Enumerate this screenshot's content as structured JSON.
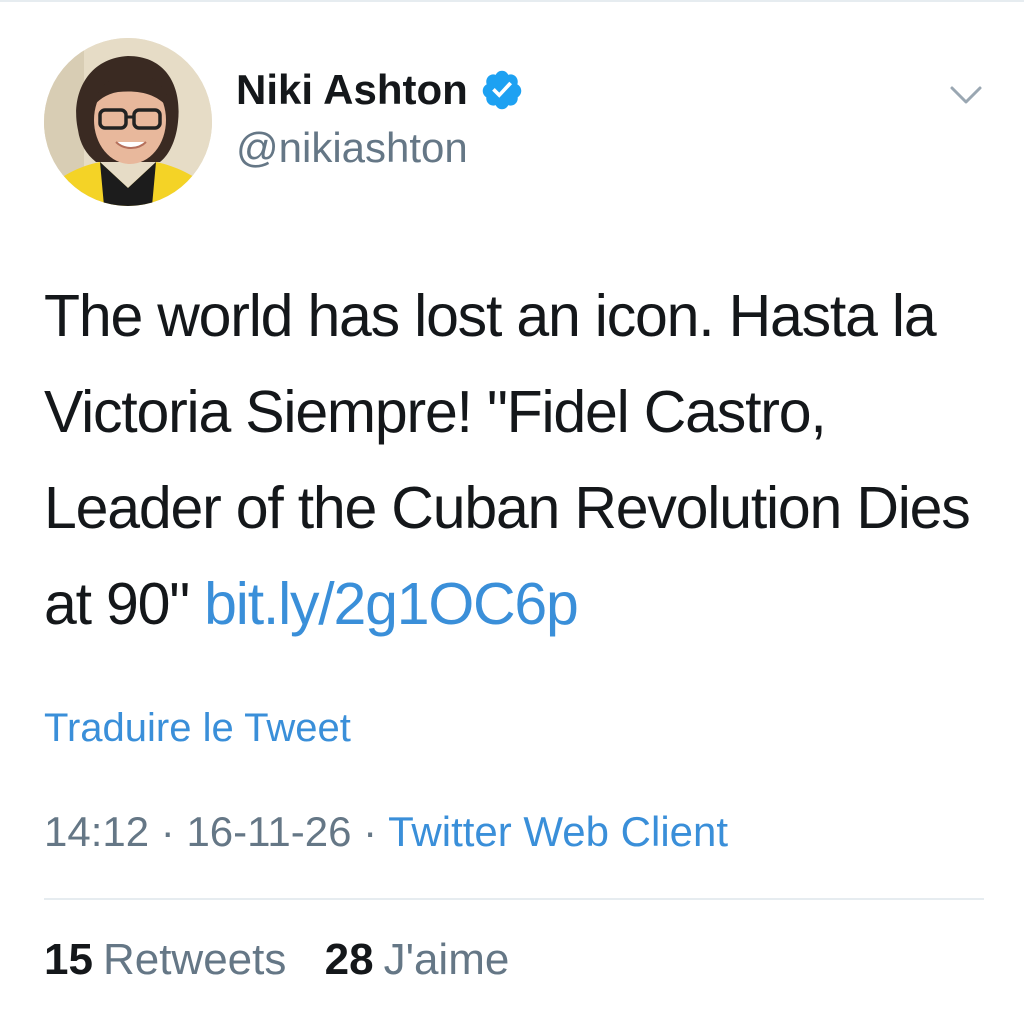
{
  "user": {
    "display_name": "Niki Ashton",
    "handle": "@nikiashton",
    "verified": true
  },
  "tweet": {
    "text": "The world has lost an icon. Hasta la Victoria Siempre! \"Fidel Castro, Leader of the Cuban Revolution Dies at 90\"",
    "link": "bit.ly/2g1OC6p",
    "translate_label": "Traduire le Tweet"
  },
  "meta": {
    "time": "14:12",
    "separator": "·",
    "date": "16-11-26",
    "client": "Twitter Web Client"
  },
  "stats": {
    "retweets_count": "15",
    "retweets_label": "Retweets",
    "likes_count": "28",
    "likes_label": "J'aime"
  },
  "icons": {
    "verified": "verified-badge-icon",
    "menu": "chevron-down-icon"
  },
  "colors": {
    "link": "#3a8fd9",
    "verified": "#1da1f2",
    "secondary_text": "#657786",
    "primary_text": "#14171a",
    "divider": "#e6ecf0"
  }
}
